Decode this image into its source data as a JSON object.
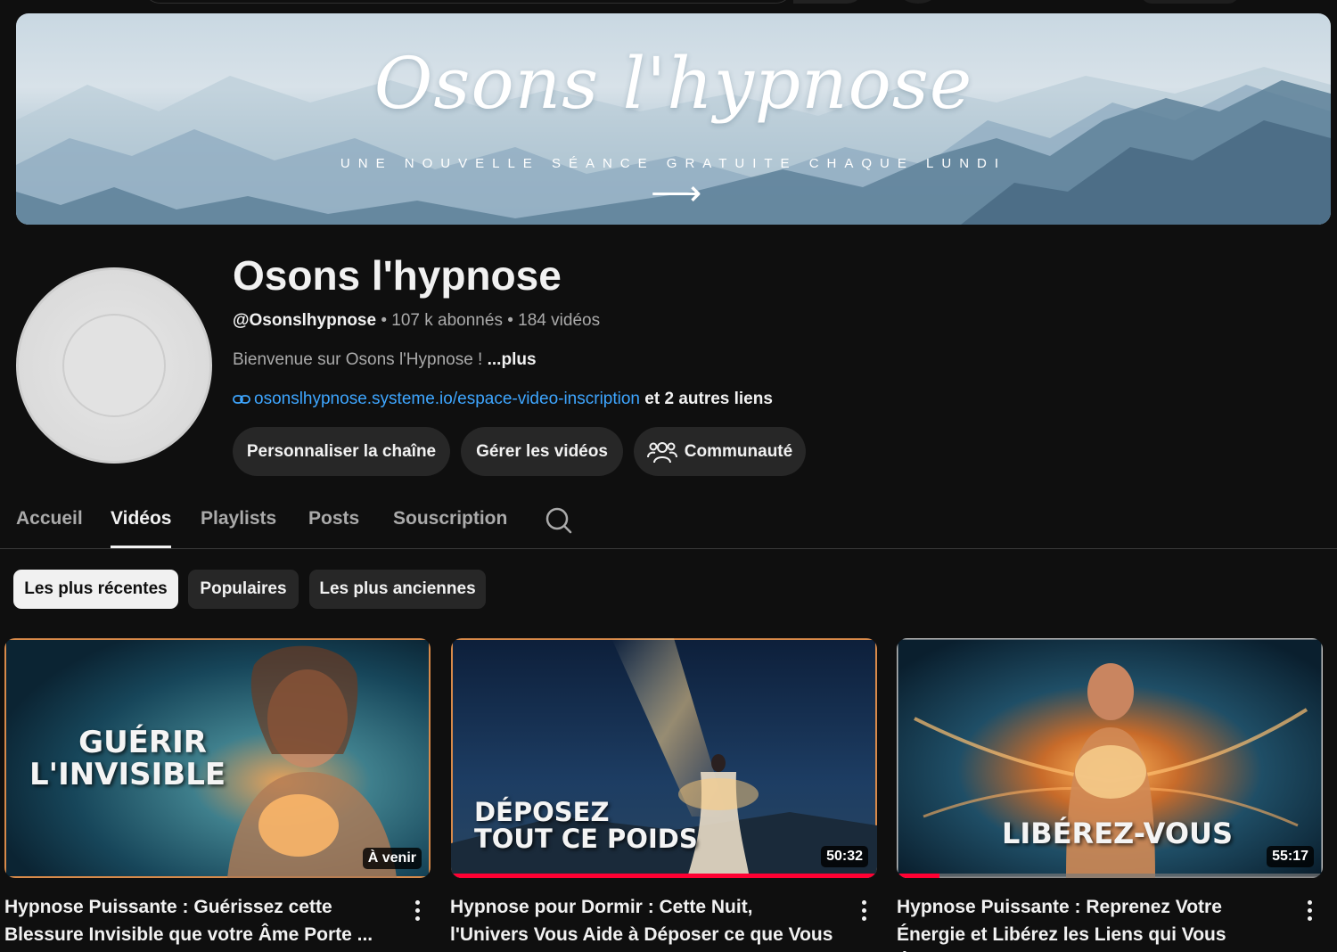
{
  "banner": {
    "title": "Osons l'hypnose",
    "subtitle": "UNE NOUVELLE SÉANCE GRATUITE CHAQUE LUNDI",
    "arrow": "⟶"
  },
  "channel": {
    "name": "Osons l'hypnose",
    "handle": "@Osonslhypnose",
    "subscribers": "107 k abonnés",
    "videos_count": "184 vidéos",
    "separator": "•",
    "description": "Bienvenue sur Osons l'Hypnose ! ",
    "more_label": "...plus",
    "link_url": "osonslhypnose.systeme.io/espace-video-inscription",
    "other_links": "et 2 autres liens"
  },
  "actions": {
    "customize": "Personnaliser la chaîne",
    "manage": "Gérer les vidéos",
    "community": "Communauté"
  },
  "tabs": [
    "Accueil",
    "Vidéos",
    "Playlists",
    "Posts",
    "Souscription"
  ],
  "active_tab": "Vidéos",
  "chips": [
    "Les plus récentes",
    "Populaires",
    "Les plus anciennes"
  ],
  "active_chip": "Les plus récentes",
  "videos": [
    {
      "thumb_text": [
        "GUÉRIR",
        "L'INVISIBLE"
      ],
      "badge": "À venir",
      "progress": 0,
      "title": "Hypnose Puissante : Guérissez cette Blessure Invisible que votre Âme Porte ..."
    },
    {
      "thumb_text": [
        "DÉPOSEZ",
        "TOUT CE POIDS"
      ],
      "badge": "50:32",
      "progress": 1.0,
      "title": "Hypnose pour Dormir : Cette Nuit, l'Univers Vous Aide à Déposer ce que Vous Portez"
    },
    {
      "thumb_text": [
        "LIBÉREZ-VOUS"
      ],
      "badge": "55:17",
      "progress": 0.1,
      "title": "Hypnose Puissante : Reprenez Votre Énergie et Libérez les Liens qui Vous Épuisent"
    }
  ],
  "colors": {
    "background": "#0f0f0f",
    "link": "#3ea6ff",
    "button": "#272727",
    "progress": "#ff0033"
  }
}
